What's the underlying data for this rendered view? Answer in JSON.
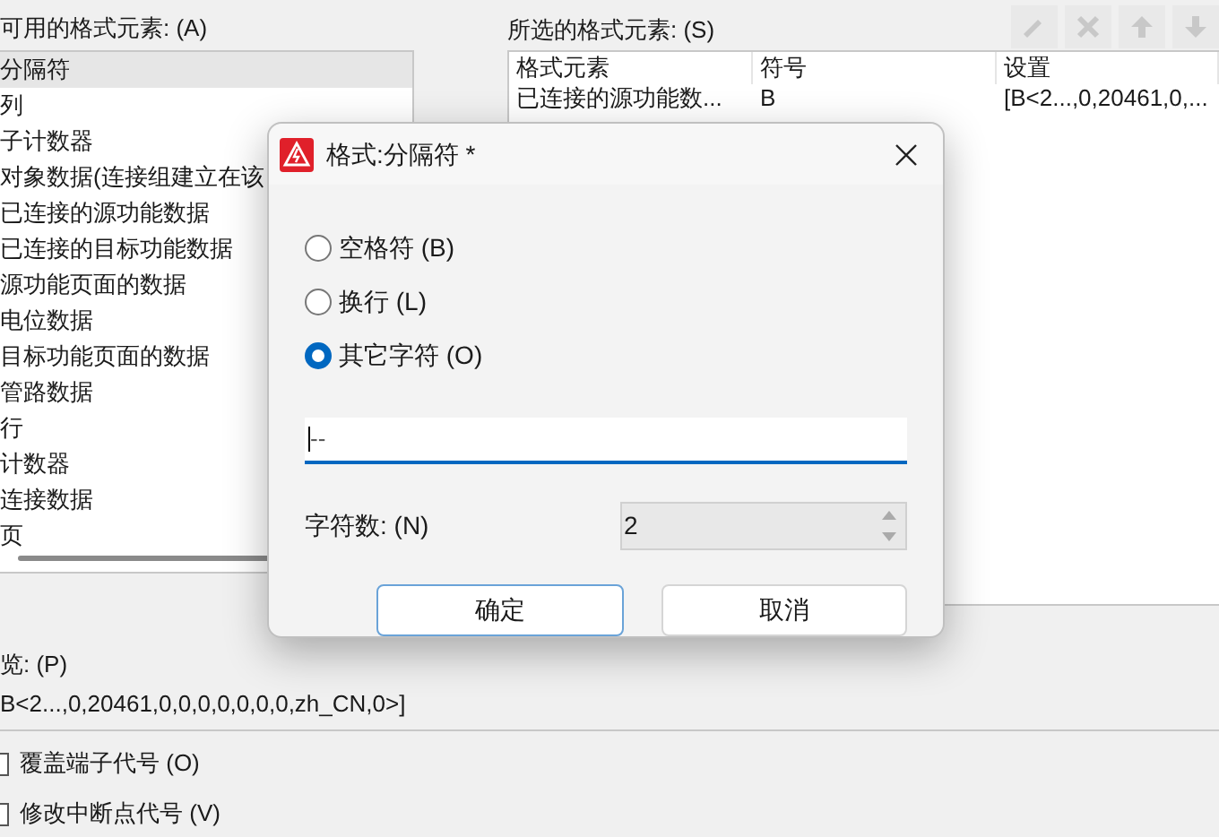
{
  "available": {
    "label": "可用的格式元素: (A)",
    "items": [
      {
        "label": "分隔符",
        "selected": true
      },
      {
        "label": "列",
        "selected": false
      },
      {
        "label": "子计数器",
        "selected": false
      },
      {
        "label": "对象数据(连接组建立在该",
        "selected": false
      },
      {
        "label": "已连接的源功能数据",
        "selected": false
      },
      {
        "label": "已连接的目标功能数据",
        "selected": false
      },
      {
        "label": "源功能页面的数据",
        "selected": false
      },
      {
        "label": "电位数据",
        "selected": false
      },
      {
        "label": "目标功能页面的数据",
        "selected": false
      },
      {
        "label": "管路数据",
        "selected": false
      },
      {
        "label": "行",
        "selected": false
      },
      {
        "label": "计数器",
        "selected": false
      },
      {
        "label": "连接数据",
        "selected": false
      },
      {
        "label": "页",
        "selected": false
      }
    ]
  },
  "selected_elements": {
    "label": "所选的格式元素: (S)",
    "toolbar": [
      {
        "kind": "edit",
        "disabled": true
      },
      {
        "kind": "delete",
        "disabled": true
      },
      {
        "kind": "up",
        "disabled": true
      },
      {
        "kind": "down",
        "disabled": true
      }
    ],
    "columns": [
      "格式元素",
      "符号",
      "设置"
    ],
    "rows": [
      [
        "已连接的源功能数...",
        "B",
        "[B<2...,0,20461,0,..."
      ]
    ]
  },
  "preview": {
    "label": "览: (P)",
    "value": "B<2...,0,20461,0,0,0,0,0,0,0,zh_CN,0>]"
  },
  "options": [
    {
      "label": "覆盖端子代号 (O)",
      "checked": false
    },
    {
      "label": "修改中断点代号 (V)",
      "checked": false
    }
  ],
  "dialog": {
    "title": "格式:分隔符 *",
    "radios": [
      {
        "label": "空格符 (B)",
        "selected": false
      },
      {
        "label": "换行 (L)",
        "selected": false
      },
      {
        "label": "其它字符 (O)",
        "selected": true
      }
    ],
    "text_value": "--",
    "count_label": "字符数: (N)",
    "count_value": "2",
    "buttons": [
      {
        "label": "确定",
        "kind": "default"
      },
      {
        "label": "取消",
        "kind": "normal"
      }
    ]
  }
}
